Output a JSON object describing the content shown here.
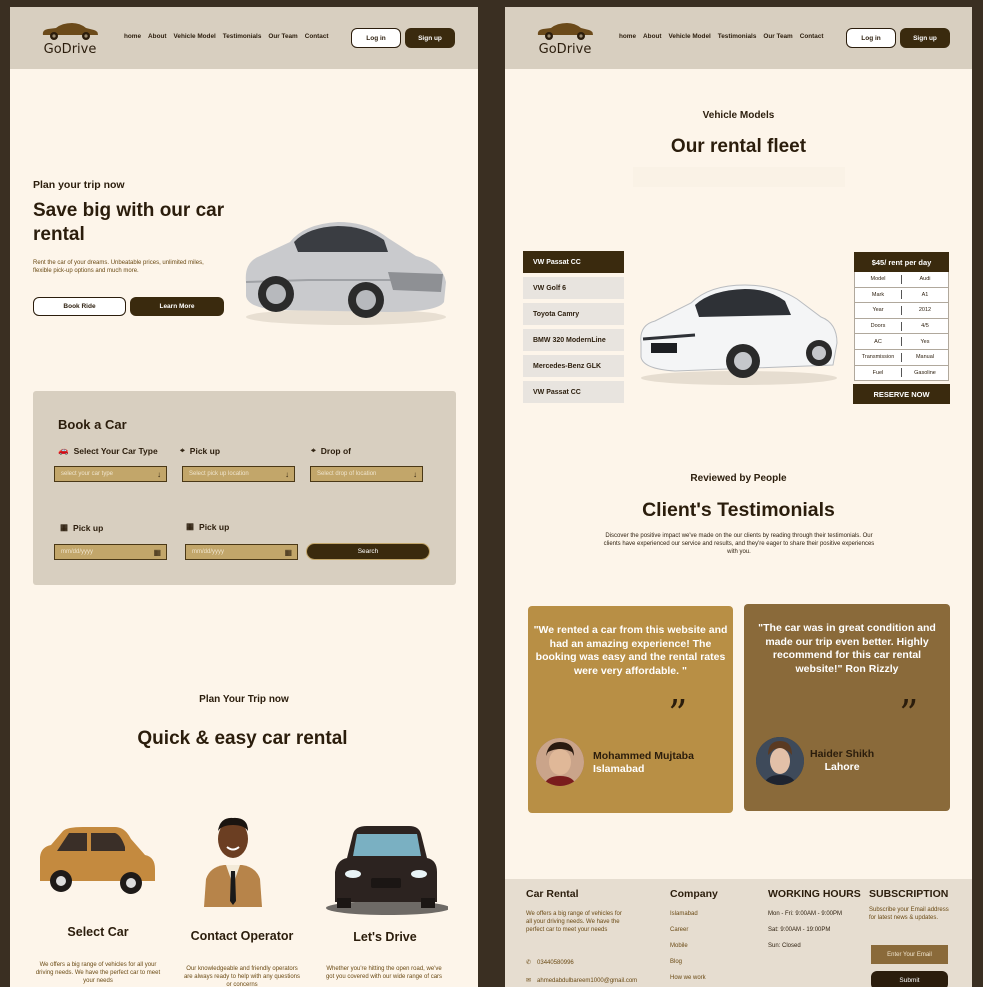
{
  "frames": [
    {
      "nav": {
        "logo": "GoDrive",
        "links": [
          "home",
          "About",
          "Vehicle Model",
          "Testimonials",
          "Our Team",
          "Contact"
        ],
        "login": "Log in",
        "signup": "Sign up"
      },
      "hero": {
        "kicker": "Plan your trip now",
        "title": "Save big with our car rental",
        "desc": "Rent the car of your dreams. Unbeatable prices, unlimited miles, flexible pick-up options and much more.",
        "book_btn": "Book Ride",
        "learn_btn": "Learn More"
      },
      "booking": {
        "title": "Book a Car",
        "car_type_label": "Select Your Car Type",
        "pickup_label": "Pick up",
        "dropoff_label": "Drop of",
        "car_type_placeholder": "select your car type",
        "pickup_loc_placeholder": "Select pick up location",
        "dropoff_placeholder": "Select drop of location",
        "date1_label": "Pick up",
        "date2_label": "Pick up",
        "date_placeholder": "mm/dd/yyyy",
        "search_btn": "Search"
      },
      "quick": {
        "kicker": "Plan Your Trip now",
        "title": "Quick & easy car rental",
        "steps": [
          {
            "title": "Select Car",
            "desc": "We offers a big range of vehicles for all your driving needs. We have the perfect car to meet your needs"
          },
          {
            "title": "Contact Operator",
            "desc": "Our knowledgeable and friendly operators are always ready to help with any questions or concerns"
          },
          {
            "title": "Let's Drive",
            "desc": "Whether you're hitting the open road, we've got you covered with our wide range of cars"
          }
        ]
      }
    },
    {
      "nav": {
        "logo": "GoDrive",
        "links": [
          "home",
          "About",
          "Vehicle Model",
          "Testimonials",
          "Our Team",
          "Contact"
        ],
        "login": "Log in",
        "signup": "Sign up"
      },
      "fleet": {
        "kicker": "Vehicle Models",
        "title": "Our rental fleet",
        "models": [
          "VW Passat CC",
          "VW Golf 6",
          "Toyota Camry",
          "BMW 320 ModernLine",
          "Mercedes-Benz GLK",
          "VW Passat CC"
        ],
        "price": "$45/ rent per day",
        "specs": [
          [
            "Model",
            "Audi"
          ],
          [
            "Mark",
            "A1"
          ],
          [
            "Year",
            "2012"
          ],
          [
            "Doors",
            "4/5"
          ],
          [
            "AC",
            "Yes"
          ],
          [
            "Transmission",
            "Manual"
          ],
          [
            "Fuel",
            "Gasoline"
          ]
        ],
        "reserve": "RESERVE NOW"
      },
      "testimonials": {
        "kicker": "Reviewed by People",
        "title": "Client's Testimonials",
        "desc": "Discover the positive impact we've made on the our clients by reading through their testimonials. Our clients have experienced our service and results, and they're eager to share their positive experiences with you.",
        "cards": [
          {
            "quote": "\"We rented a car from this website and had an amazing experience! The booking was easy and the rental rates were very affordable. \"",
            "name": "Mohammed Mujtaba",
            "city": "Islamabad",
            "bg": "#b88f45"
          },
          {
            "quote": "\"The car was in great condition and made our trip even better. Highly recommend for this car rental website!\" Ron Rizzly",
            "name": "Haider Shikh",
            "city": "Lahore",
            "bg": "#8a6a3a"
          }
        ]
      },
      "footer": {
        "col1_title": "Car Rental",
        "col1_desc": "We offers a big range of vehicles for all your driving needs. We have the perfect car to meet your needs",
        "phone": "03440580996",
        "email": "ahmedabdulbareem1000@gmail.com",
        "col2_title": "Company",
        "company_links": [
          "Islamabad",
          "Career",
          "Mobile",
          "Blog",
          "How we work"
        ],
        "col3_title": "WORKING HOURS",
        "hours": [
          "Mon - Fri: 9:00AM - 9:00PM",
          "Sat: 9:00AM - 19:00PM",
          "Sun: Closed"
        ],
        "col4_title": "SUBSCRIPTION",
        "sub_desc": "Subscribe your Email address for latest news & updates.",
        "email_placeholder": "Enter Your Email",
        "submit": "Submit"
      }
    }
  ]
}
